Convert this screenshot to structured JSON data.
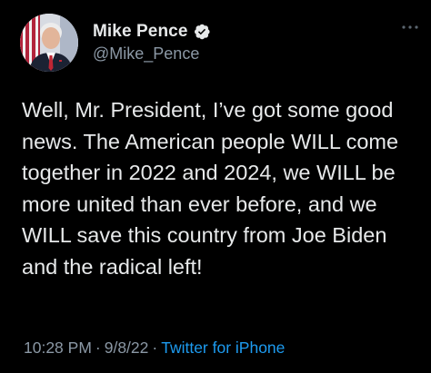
{
  "author": {
    "display_name": "Mike Pence",
    "handle": "@Mike_Pence",
    "verified": true,
    "avatar_icon": "profile-photo"
  },
  "tweet": {
    "text": "Well, Mr. President, I’ve got some good news. The American people WILL come together in 2022 and 2024, we WILL be more united than ever before, and we WILL save this country from Joe Biden and the radical left!",
    "time": "10:28 PM",
    "separator_1": "·",
    "date": "9/8/22",
    "separator_2": "·",
    "source": "Twitter for iPhone"
  },
  "colors": {
    "background": "#000000",
    "text_primary": "#e7e9ea",
    "text_secondary": "#8b98a5",
    "accent_blue": "#1d9bf0"
  },
  "icons": {
    "verified": "verified-badge-icon",
    "more": "more-options-icon"
  }
}
